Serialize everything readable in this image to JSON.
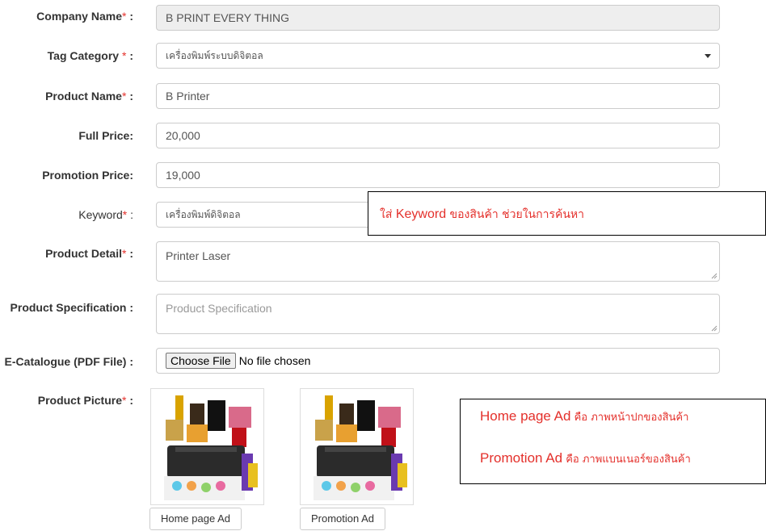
{
  "form": {
    "company": {
      "label": "Company Name",
      "req": "*",
      "colon": " :",
      "value": "B PRINT EVERY THING"
    },
    "tag": {
      "label": "Tag Category",
      "req": " *",
      "colon": " :",
      "value": "เครื่องพิมพ์ระบบดิจิตอล"
    },
    "product_name": {
      "label": "Product Name",
      "req": "*",
      "colon": " :",
      "value": "B Printer"
    },
    "full_price": {
      "label": "Full Price:",
      "value": "20,000"
    },
    "promo_price": {
      "label": "Promotion Price:",
      "value": "19,000"
    },
    "keyword": {
      "label": "Keyword",
      "req": "*",
      "colon": " :",
      "value": "เครื่องพิมพ์ดิจิตอล"
    },
    "detail": {
      "label": "Product Detail",
      "req": "*",
      "colon": " :",
      "value": "Printer Laser"
    },
    "spec": {
      "label": "Product Specification :",
      "placeholder": "Product Specification"
    },
    "catalogue": {
      "label": "E-Catalogue (PDF File) :",
      "button": "Choose File",
      "status": "No file chosen"
    },
    "picture": {
      "label": "Product Picture",
      "req": "*",
      "colon": " :",
      "home_button": "Home page Ad",
      "promo_button": "Promotion Ad"
    }
  },
  "callouts": {
    "keyword": {
      "prefix": "ใส่ ",
      "en": "Keyword",
      "suffix": " ของสินค้า ช่วยในการค้นหา"
    },
    "ads": [
      {
        "en": "Home page Ad",
        "suffix": " คือ ภาพหน้าปกของสินค้า"
      },
      {
        "en": "Promotion Ad",
        "suffix": " คือ ภาพแบนเนอร์ของสินค้า"
      }
    ]
  },
  "colors": {
    "required": "#e4302b",
    "callout_text": "#e4302b",
    "readonly_bg": "#eeeeee"
  }
}
